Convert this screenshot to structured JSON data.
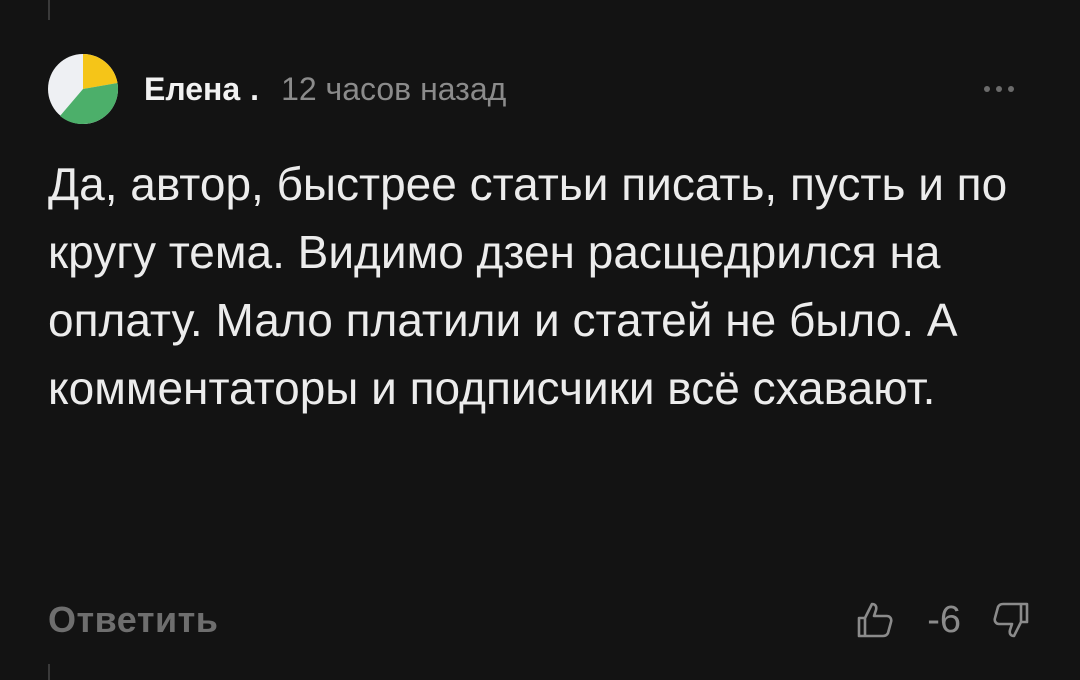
{
  "comment": {
    "author": "Елена",
    "separator": ".",
    "time": "12 часов назад",
    "text": "Да, автор, быстрее статьи писать, пусть и по кругу тема. Видимо дзен расщедрился на оплату. Мало платили и статей не было. А комментаторы и подписчики всё схавают.",
    "reply_label": "Ответить",
    "score": "-6",
    "avatar_colors": {
      "yellow": "#f5c518",
      "green": "#4caf6a",
      "light": "#eef0f3"
    }
  },
  "icons": {
    "more": "more-horizontal-icon",
    "like": "thumbs-up-icon",
    "dislike": "thumbs-down-icon"
  },
  "colors": {
    "background": "#131313",
    "text": "#ececec",
    "muted": "#8b8b8b"
  }
}
